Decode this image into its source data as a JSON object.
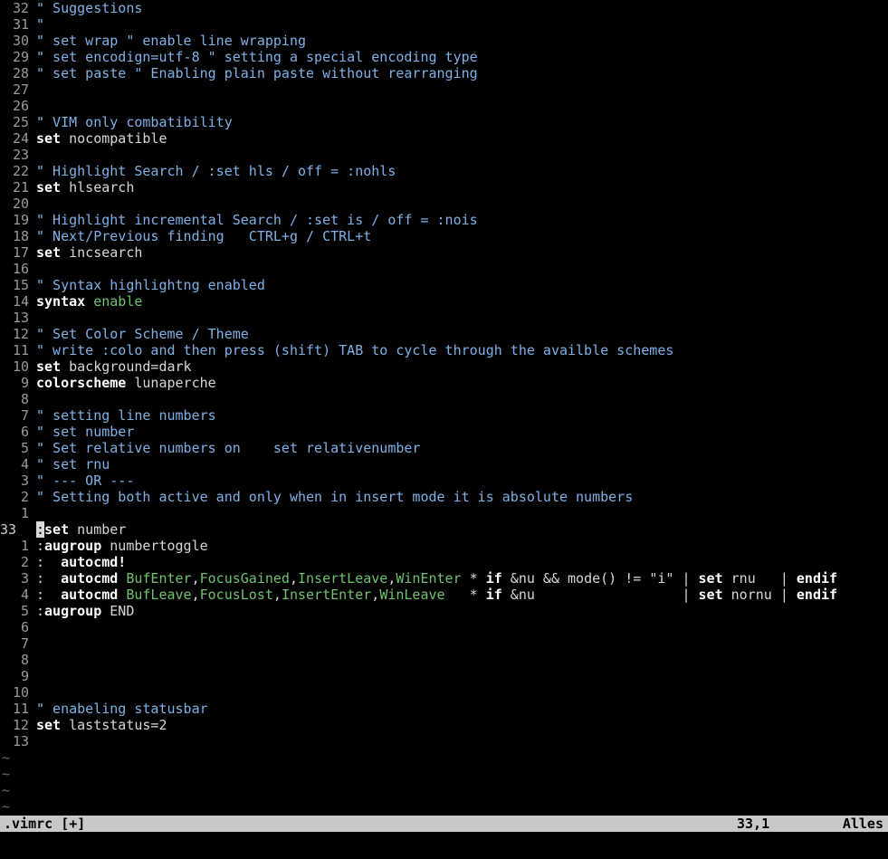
{
  "editor": {
    "lines": [
      {
        "num": "32",
        "segs": [
          {
            "t": "\" Suggestions",
            "c": "c"
          }
        ]
      },
      {
        "num": "31",
        "segs": [
          {
            "t": "\"",
            "c": "c"
          }
        ]
      },
      {
        "num": "30",
        "segs": [
          {
            "t": "\" set wrap \" enable line wrapping",
            "c": "c"
          }
        ]
      },
      {
        "num": "29",
        "segs": [
          {
            "t": "\" set encodign=utf-8 \" setting a special encoding type",
            "c": "c"
          }
        ]
      },
      {
        "num": "28",
        "segs": [
          {
            "t": "\" set paste \" Enabling plain paste without rearranging",
            "c": "c"
          }
        ]
      },
      {
        "num": "27",
        "segs": []
      },
      {
        "num": "26",
        "segs": []
      },
      {
        "num": "25",
        "segs": [
          {
            "t": "\" VIM only combatibility",
            "c": "c"
          }
        ]
      },
      {
        "num": "24",
        "segs": [
          {
            "t": "set",
            "c": "k"
          },
          {
            "t": " nocompatible",
            "c": "t"
          }
        ]
      },
      {
        "num": "23",
        "segs": []
      },
      {
        "num": "22",
        "segs": [
          {
            "t": "\" Highlight Search / :set hls / off = :nohls",
            "c": "c"
          }
        ]
      },
      {
        "num": "21",
        "segs": [
          {
            "t": "set",
            "c": "k"
          },
          {
            "t": " hlsearch",
            "c": "t"
          }
        ]
      },
      {
        "num": "20",
        "segs": []
      },
      {
        "num": "19",
        "segs": [
          {
            "t": "\" Highlight incremental Search / :set is / off = :nois",
            "c": "c"
          }
        ]
      },
      {
        "num": "18",
        "segs": [
          {
            "t": "\" Next/Previous finding   CTRL+g / CTRL+t",
            "c": "c"
          }
        ]
      },
      {
        "num": "17",
        "segs": [
          {
            "t": "set",
            "c": "k"
          },
          {
            "t": " incsearch",
            "c": "t"
          }
        ]
      },
      {
        "num": "16",
        "segs": []
      },
      {
        "num": "15",
        "segs": [
          {
            "t": "\" Syntax highlightng enabled",
            "c": "c"
          }
        ]
      },
      {
        "num": "14",
        "segs": [
          {
            "t": "syntax",
            "c": "k"
          },
          {
            "t": " ",
            "c": "t"
          },
          {
            "t": "enable",
            "c": "g"
          }
        ]
      },
      {
        "num": "13",
        "segs": []
      },
      {
        "num": "12",
        "segs": [
          {
            "t": "\" Set Color Scheme / Theme",
            "c": "c"
          }
        ]
      },
      {
        "num": "11",
        "segs": [
          {
            "t": "\" write :colo and then press (shift) TAB to cycle through the availble schemes",
            "c": "c"
          }
        ]
      },
      {
        "num": "10",
        "segs": [
          {
            "t": "set",
            "c": "k"
          },
          {
            "t": " background=dark",
            "c": "t"
          }
        ]
      },
      {
        "num": "9",
        "segs": [
          {
            "t": "colorscheme",
            "c": "k"
          },
          {
            "t": " lunaperche",
            "c": "t"
          }
        ]
      },
      {
        "num": "8",
        "segs": []
      },
      {
        "num": "7",
        "segs": [
          {
            "t": "\" setting line numbers",
            "c": "c"
          }
        ]
      },
      {
        "num": "6",
        "segs": [
          {
            "t": "\" set number",
            "c": "c"
          }
        ]
      },
      {
        "num": "5",
        "segs": [
          {
            "t": "\" Set relative numbers on    set relativenumber",
            "c": "c"
          }
        ]
      },
      {
        "num": "4",
        "segs": [
          {
            "t": "\" set rnu",
            "c": "c"
          }
        ]
      },
      {
        "num": "3",
        "segs": [
          {
            "t": "\" --- OR ---",
            "c": "c"
          }
        ]
      },
      {
        "num": "2",
        "segs": [
          {
            "t": "\" Setting both active and only when in insert mode it is absolute numbers",
            "c": "c"
          }
        ]
      },
      {
        "num": "1",
        "segs": []
      },
      {
        "num": "33",
        "current": true,
        "segs": [
          {
            "t": ":",
            "c": "cursor"
          },
          {
            "t": "set",
            "c": "k"
          },
          {
            "t": " number",
            "c": "t"
          }
        ]
      },
      {
        "num": "1",
        "segs": [
          {
            "t": ":",
            "c": "t"
          },
          {
            "t": "augroup",
            "c": "k"
          },
          {
            "t": " numbertoggle",
            "c": "t"
          }
        ]
      },
      {
        "num": "2",
        "segs": [
          {
            "t": ":  ",
            "c": "t"
          },
          {
            "t": "autocmd!",
            "c": "k"
          }
        ]
      },
      {
        "num": "3",
        "segs": [
          {
            "t": ":  ",
            "c": "t"
          },
          {
            "t": "autocmd",
            "c": "k"
          },
          {
            "t": " ",
            "c": "t"
          },
          {
            "t": "BufEnter",
            "c": "g"
          },
          {
            "t": ",",
            "c": "t"
          },
          {
            "t": "FocusGained",
            "c": "g"
          },
          {
            "t": ",",
            "c": "t"
          },
          {
            "t": "InsertLeave",
            "c": "g"
          },
          {
            "t": ",",
            "c": "t"
          },
          {
            "t": "WinEnter",
            "c": "g"
          },
          {
            "t": " * ",
            "c": "t"
          },
          {
            "t": "if",
            "c": "k"
          },
          {
            "t": " &nu && mode() != \"i\" | ",
            "c": "t"
          },
          {
            "t": "set",
            "c": "k"
          },
          {
            "t": " rnu   | ",
            "c": "t"
          },
          {
            "t": "endif",
            "c": "k"
          }
        ]
      },
      {
        "num": "4",
        "segs": [
          {
            "t": ":  ",
            "c": "t"
          },
          {
            "t": "autocmd",
            "c": "k"
          },
          {
            "t": " ",
            "c": "t"
          },
          {
            "t": "BufLeave",
            "c": "g"
          },
          {
            "t": ",",
            "c": "t"
          },
          {
            "t": "FocusLost",
            "c": "g"
          },
          {
            "t": ",",
            "c": "t"
          },
          {
            "t": "InsertEnter",
            "c": "g"
          },
          {
            "t": ",",
            "c": "t"
          },
          {
            "t": "WinLeave",
            "c": "g"
          },
          {
            "t": "   * ",
            "c": "t"
          },
          {
            "t": "if",
            "c": "k"
          },
          {
            "t": " &nu                  | ",
            "c": "t"
          },
          {
            "t": "set",
            "c": "k"
          },
          {
            "t": " nornu | ",
            "c": "t"
          },
          {
            "t": "endif",
            "c": "k"
          }
        ]
      },
      {
        "num": "5",
        "segs": [
          {
            "t": ":",
            "c": "t"
          },
          {
            "t": "augroup",
            "c": "k"
          },
          {
            "t": " END",
            "c": "t"
          }
        ]
      },
      {
        "num": "6",
        "segs": []
      },
      {
        "num": "7",
        "segs": []
      },
      {
        "num": "8",
        "segs": []
      },
      {
        "num": "9",
        "segs": []
      },
      {
        "num": "10",
        "segs": []
      },
      {
        "num": "11",
        "segs": [
          {
            "t": "\" enabeling statusbar",
            "c": "c"
          }
        ]
      },
      {
        "num": "12",
        "segs": [
          {
            "t": "set",
            "c": "k"
          },
          {
            "t": " laststatus=2",
            "c": "t"
          }
        ]
      },
      {
        "num": "13",
        "segs": []
      }
    ],
    "filler": [
      "~",
      "~",
      "~",
      "~"
    ]
  },
  "statusline": {
    "filename": ".vimrc [+]",
    "position": "33,1",
    "scroll": "Alles"
  },
  "colors": {
    "background": "#000000",
    "comment": "#7fb0e6",
    "keyword": "#ffffff",
    "event": "#6fc26f",
    "statusline_bg": "#c8c8c8"
  }
}
